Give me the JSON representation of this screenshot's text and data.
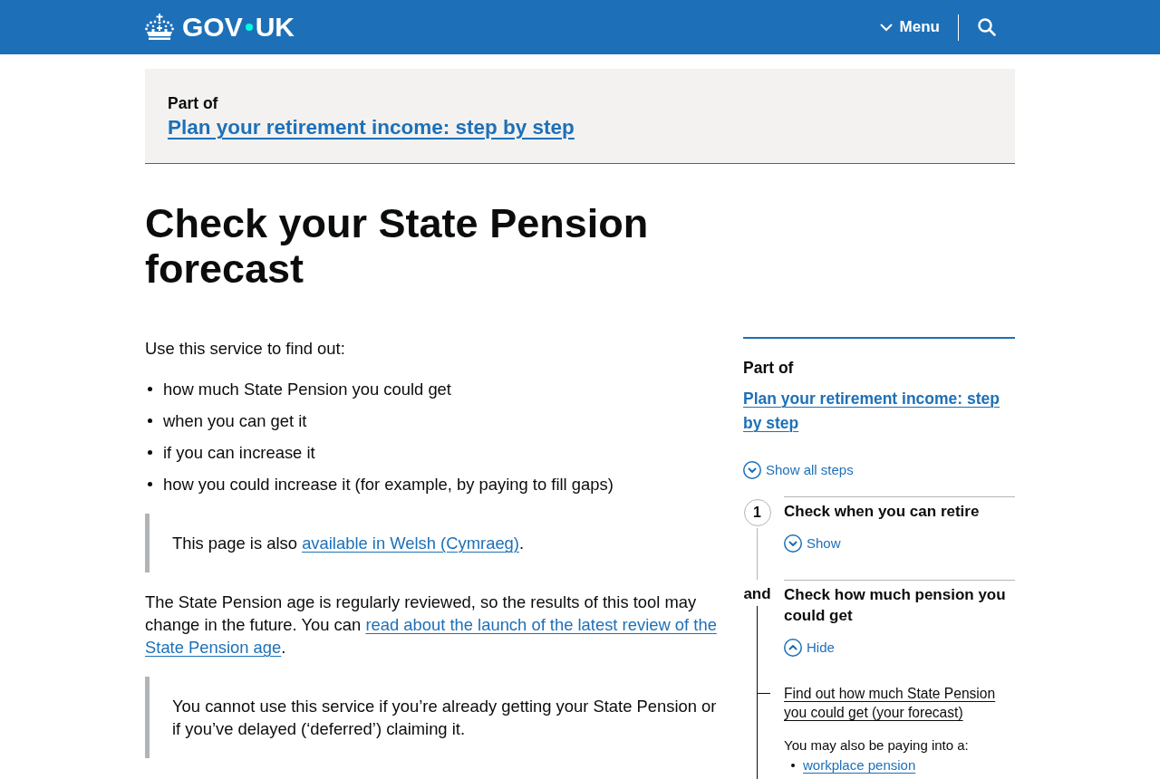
{
  "header": {
    "logo": [
      "GOV",
      "UK"
    ],
    "menu_button": {
      "label": "Menu",
      "expanded": false
    }
  },
  "part_of_banner": {
    "label": "Part of",
    "link": "Plan your retirement income: step by step"
  },
  "title": "Check your State Pension forecast",
  "content": [
    {
      "kind": "paragraph",
      "parts": [
        {
          "kind": "text",
          "text": "Use this service to find out:"
        }
      ]
    },
    {
      "kind": "list",
      "items": [
        "how much State Pension you could get",
        "when you can get it",
        "if you can increase it",
        "how you could increase it (for example, by paying to fill gaps)"
      ]
    },
    {
      "kind": "inset",
      "parts": [
        {
          "kind": "text",
          "text": "This page is also "
        },
        {
          "kind": "link",
          "text": "available in Welsh (Cymraeg)"
        },
        {
          "kind": "text",
          "text": "."
        }
      ]
    },
    {
      "kind": "paragraph",
      "parts": [
        {
          "kind": "text",
          "text": "The State Pension age is regularly reviewed, so the results of this tool may change in the future. You can "
        },
        {
          "kind": "link",
          "text": "read about the launch of the latest review of the"
        },
        {
          "kind": "link",
          "text": "State Pension age"
        },
        {
          "kind": "text",
          "text": "."
        }
      ]
    },
    {
      "kind": "inset",
      "parts": [
        {
          "kind": "text",
          "text": "You cannot use this service if you’re already getting your State Pension or if you’ve delayed (‘deferred’) claiming it."
        }
      ]
    }
  ],
  "step_nav": {
    "part_of": {
      "label": "Part of",
      "link": "Plan your retirement income: step by step"
    },
    "show_all": {
      "label": "Show all steps",
      "expanded": false
    },
    "steps": [
      {
        "marker": {
          "kind": "number",
          "text": "1"
        },
        "title": "Check when you can retire",
        "current": false,
        "expanded": false,
        "toggle": "Show"
      },
      {
        "marker": {
          "kind": "and",
          "text": "and"
        },
        "title": "Check how much pension you could get",
        "current": true,
        "expanded": true,
        "toggle": "Hide",
        "items": [
          {
            "kind": "link",
            "text": "Find out how much State Pension you could get (your forecast)",
            "current": true
          },
          {
            "kind": "paragraph",
            "text": "You may also be paying into a:"
          },
          {
            "kind": "list",
            "items": [
              {
                "kind": "link",
                "text": "workplace pension"
              }
            ]
          }
        ]
      }
    ]
  }
}
